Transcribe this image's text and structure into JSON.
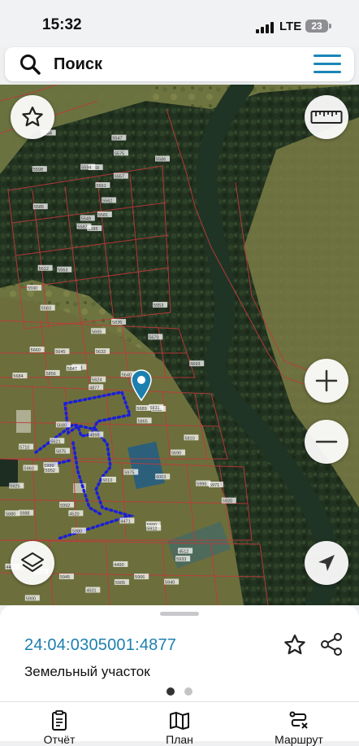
{
  "status_bar": {
    "time": "15:32",
    "network": "LTE",
    "battery": "23"
  },
  "search": {
    "placeholder": "Поиск"
  },
  "parcel_labels": [
    "5595",
    "5598",
    "5549",
    "5590",
    "5562",
    "5563",
    "5547",
    "5559",
    "5575",
    "5581",
    "5564",
    "5553",
    "5585",
    "5586",
    "5587",
    "5557",
    "5583",
    "5594",
    "5561",
    "5612",
    "5614",
    "5710",
    "5621",
    "5633",
    "5640",
    "5652",
    "5660",
    "5665",
    "5684",
    "5689",
    "5693",
    "4877",
    "4898",
    "5624",
    "5645",
    "5670",
    "5680",
    "5690",
    "5810",
    "5831",
    "5836",
    "5847",
    "5856",
    "5865",
    "5875",
    "5880",
    "5890",
    "5900",
    "5905",
    "5912",
    "5918",
    "5920",
    "5925",
    "5933",
    "5940",
    "5945",
    "5952",
    "5960",
    "5966",
    "5971",
    "5975",
    "5980",
    "5988",
    "5992",
    "5996",
    "5999",
    "6003",
    "6010",
    "4471",
    "4486",
    "4490",
    "4501",
    "4512",
    "4520"
  ],
  "selected_parcel": {
    "cadastral_number": "24:04:0305001:4877",
    "type": "Земельный участок"
  },
  "pagination": {
    "total": 2,
    "active": 0
  },
  "nav": [
    {
      "label": "Отчёт",
      "icon": "report-icon"
    },
    {
      "label": "План",
      "icon": "plan-map-icon"
    },
    {
      "label": "Маршрут",
      "icon": "route-icon"
    }
  ],
  "colors": {
    "accent": "#1b7fb0",
    "parcel_border": "#c0393b",
    "selection": "#1a1fd6",
    "river": "#1f3424"
  }
}
